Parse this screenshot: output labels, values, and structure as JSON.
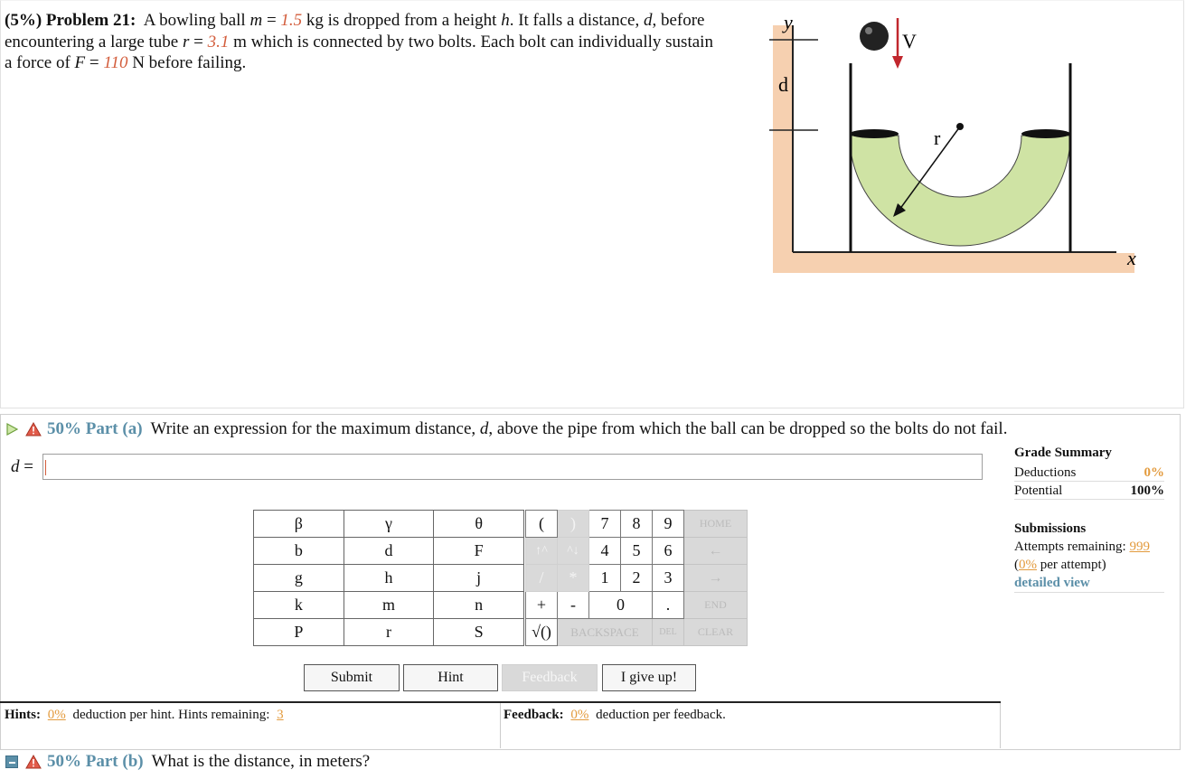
{
  "problem": {
    "header": "(5%) Problem 21:",
    "text_1": "A bowling ball",
    "m_symbol": "m",
    "eq": "=",
    "m_value": "1.5",
    "m_unit": "kg is dropped from a height",
    "h_symbol": "h",
    "text_2": ". It falls a distance,",
    "d_symbol": "d",
    "text_3": ", before encountering a large tube",
    "r_symbol": "r",
    "r_value": "3.1",
    "text_4": "m which is connected by two bolts. Each bolt can individually sustain a force of",
    "F_symbol": "F",
    "F_value": "110",
    "text_5": "N before failing."
  },
  "figure": {
    "y_label": "y",
    "x_label": "x",
    "d_label": "d",
    "r_label": "r",
    "v_label": "V",
    "tube_color": "#cfe3a4",
    "ground_color": "#f6d0b0",
    "arrow_color": "#c1272d"
  },
  "part_a": {
    "percent": "50% Part (a)",
    "question_1": "Write an expression for the maximum distance,",
    "question_d": "d",
    "question_2": ", above the pipe from which the ball can be dropped so the bolts do not fail.",
    "answer_label_var": "d",
    "answer_label_eq": "=",
    "answer_value": ""
  },
  "grade_summary": {
    "title": "Grade Summary",
    "deductions_label": "Deductions",
    "deductions_value": "0%",
    "potential_label": "Potential",
    "potential_value": "100%"
  },
  "submissions": {
    "title": "Submissions",
    "attempts_label": "Attempts remaining:",
    "attempts_value": "999",
    "per_attempt_open": "(",
    "per_attempt_value": "0%",
    "per_attempt_label": "per attempt)",
    "detailed_view": "detailed view"
  },
  "keypad": {
    "vars": [
      [
        "β",
        "γ",
        "θ"
      ],
      [
        "b",
        "d",
        "F"
      ],
      [
        "g",
        "h",
        "j"
      ],
      [
        "k",
        "m",
        "n"
      ],
      [
        "P",
        "r",
        "S"
      ]
    ],
    "open_paren": "(",
    "close_paren": ")",
    "up_caret": "↑^",
    "down_caret": "^↓",
    "slash": "/",
    "star": "*",
    "plus": "+",
    "minus": "-",
    "sqrt": "√()",
    "backspace": "BACKSPACE",
    "del": "DEL",
    "clear": "CLEAR",
    "home": "HOME",
    "left": "←",
    "right": "→",
    "end": "END",
    "digits": [
      "7",
      "8",
      "9",
      "4",
      "5",
      "6",
      "1",
      "2",
      "3",
      "0"
    ],
    "dot": "."
  },
  "buttons": {
    "submit": "Submit",
    "hint": "Hint",
    "feedback": "Feedback",
    "give_up": "I give up!"
  },
  "hints": {
    "label": "Hints:",
    "deduction": "0%",
    "text": "deduction per hint. Hints remaining:",
    "remaining": "3"
  },
  "feedback": {
    "label": "Feedback:",
    "deduction": "0%",
    "text": "deduction per feedback."
  },
  "part_b": {
    "percent": "50% Part (b)",
    "question": "What is the distance, in meters?"
  }
}
